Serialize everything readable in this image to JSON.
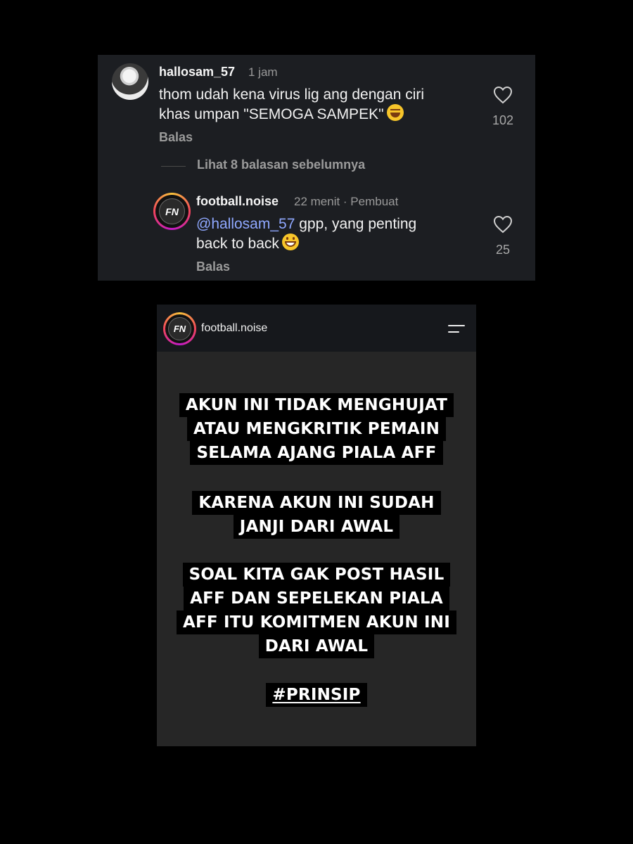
{
  "comments": {
    "parent": {
      "username": "hallosam_57",
      "time": "1 jam",
      "text_line1": "thom udah kena virus lig ang dengan ciri",
      "text_line2": "khas umpan \"SEMOGA SAMPEK\"",
      "emoji": "rolling-on-floor-laughing",
      "reply_label": "Balas",
      "likes": "102"
    },
    "view_more_label": "Lihat 8 balasan sebelumnya",
    "reply": {
      "username": "football.noise",
      "time": "22 menit · Pembuat",
      "mention": "@hallosam_57",
      "text_line1": " gpp, yang penting",
      "text_line2": "back to back",
      "emoji": "grinning-face",
      "reply_label": "Balas",
      "likes": "25",
      "avatar_label": "FN"
    }
  },
  "story": {
    "account": "football.noise",
    "avatar_label": "FN",
    "menu_icon": "menu-icon",
    "blocks": [
      {
        "lines": [
          "AKUN INI TIDAK MENGHUJAT",
          "ATAU MENGKRITIK PEMAIN",
          "SELAMA AJANG PIALA AFF"
        ]
      },
      {
        "lines": [
          "KARENA AKUN INI SUDAH",
          "JANJI DARI AWAL"
        ]
      },
      {
        "lines": [
          "SOAL KITA GAK POST HASIL",
          "AFF DAN SEPELEKAN PIALA",
          "AFF ITU KOMITMEN AKUN INI",
          "DARI AWAL"
        ]
      },
      {
        "lines": [
          "#PRINSIP"
        ]
      }
    ]
  },
  "colors": {
    "background": "#000000",
    "card": "#1c1e22",
    "mention": "#8fa8ff",
    "story_bg": "#262626"
  }
}
